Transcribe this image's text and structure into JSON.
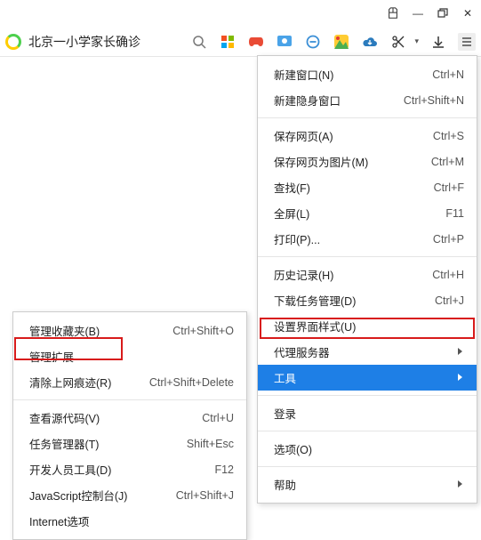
{
  "titlebar": {
    "ext_icon": "👕",
    "min": "—",
    "restore": "❐",
    "close": "✕"
  },
  "toolbar": {
    "address_text": "北京一小学家长确诊",
    "icons": {
      "search": "search-icon",
      "grid": "grid-icon",
      "gamepad": "gamepad-icon",
      "screenshot": "screenshot-icon",
      "circle_dash": "circle-dash-icon",
      "colorful": "colorful-icon",
      "download_cloud": "download-cloud-icon",
      "scissors": "scissors-icon",
      "download_arrow": "download-arrow-icon",
      "hamburger": "hamburger-icon"
    }
  },
  "main_menu": [
    {
      "label": "新建窗口(N)",
      "shortcut": "Ctrl+N"
    },
    {
      "label": "新建隐身窗口",
      "shortcut": "Ctrl+Shift+N"
    },
    {
      "sep": true
    },
    {
      "label": "保存网页(A)",
      "shortcut": "Ctrl+S"
    },
    {
      "label": "保存网页为图片(M)",
      "shortcut": "Ctrl+M"
    },
    {
      "label": "查找(F)",
      "shortcut": "Ctrl+F"
    },
    {
      "label": "全屏(L)",
      "shortcut": "F11"
    },
    {
      "label": "打印(P)...",
      "shortcut": "Ctrl+P"
    },
    {
      "sep": true
    },
    {
      "label": "历史记录(H)",
      "shortcut": "Ctrl+H"
    },
    {
      "label": "下载任务管理(D)",
      "shortcut": "Ctrl+J"
    },
    {
      "label": "设置界面样式(U)",
      "shortcut": ""
    },
    {
      "label": "代理服务器",
      "shortcut": "",
      "arrow": true
    },
    {
      "label": "工具",
      "shortcut": "",
      "arrow": true,
      "highlight": true
    },
    {
      "sep": true
    },
    {
      "label": "登录",
      "shortcut": ""
    },
    {
      "sep": true
    },
    {
      "label": "选项(O)",
      "shortcut": ""
    },
    {
      "sep": true
    },
    {
      "label": "帮助",
      "shortcut": "",
      "arrow": true
    }
  ],
  "sub_menu": [
    {
      "label": "管理收藏夹(B)",
      "shortcut": "Ctrl+Shift+O"
    },
    {
      "label": "管理扩展",
      "shortcut": ""
    },
    {
      "label": "清除上网痕迹(R)",
      "shortcut": "Ctrl+Shift+Delete"
    },
    {
      "sep": true
    },
    {
      "label": "查看源代码(V)",
      "shortcut": "Ctrl+U"
    },
    {
      "label": "任务管理器(T)",
      "shortcut": "Shift+Esc"
    },
    {
      "label": "开发人员工具(D)",
      "shortcut": "F12"
    },
    {
      "label": "JavaScript控制台(J)",
      "shortcut": "Ctrl+Shift+J"
    },
    {
      "label": "Internet选项",
      "shortcut": ""
    }
  ]
}
